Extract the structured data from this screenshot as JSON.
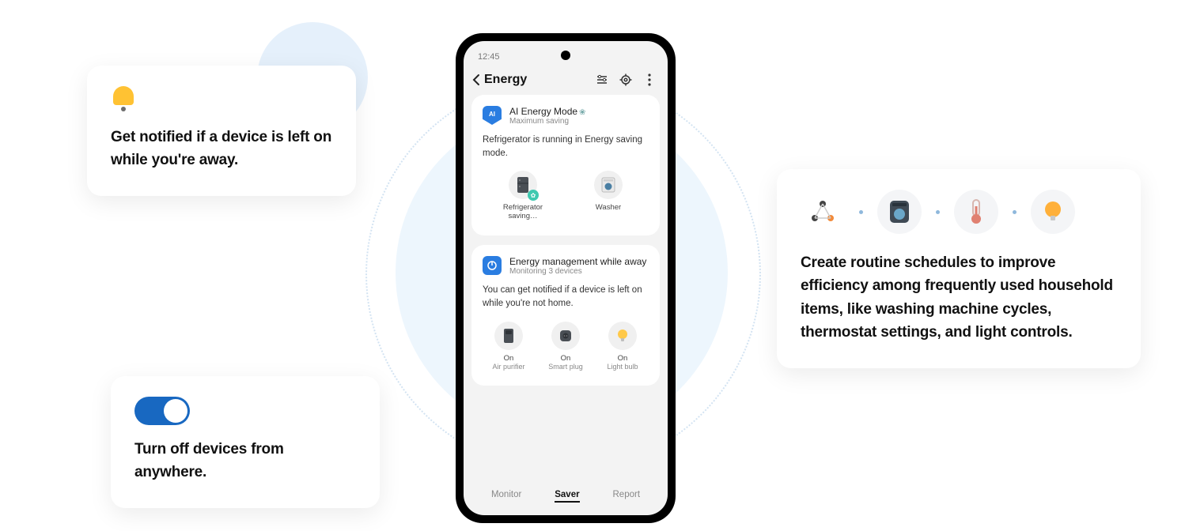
{
  "left_card_notify": {
    "text": "Get notified if a device is left on while you're away."
  },
  "left_card_toggle": {
    "text": "Turn off devices from anywhere."
  },
  "right_card_routine": {
    "text": "Create routine schedules to improve efficiency among frequently used household items, like washing machine cycles, thermostat settings, and light controls."
  },
  "phone": {
    "status_time": "12:45",
    "header": {
      "title": "Energy"
    },
    "panel_ai": {
      "badge_text": "AI",
      "title": "AI Energy Mode",
      "subtitle": "Maximum saving",
      "description": "Refrigerator is running in Energy saving mode.",
      "devices": [
        {
          "label_line1": "Refrigerator",
          "label_line2": "saving…"
        },
        {
          "label_line1": "Washer",
          "label_line2": ""
        }
      ]
    },
    "panel_away": {
      "title": "Energy management while away",
      "subtitle": "Monitoring 3 devices",
      "description": "You can get notified if a device is left on while you're not home.",
      "devices": [
        {
          "status": "On",
          "label": "Air purifier"
        },
        {
          "status": "On",
          "label": "Smart plug"
        },
        {
          "status": "On",
          "label": "Light bulb"
        }
      ]
    },
    "tabs": {
      "monitor": "Monitor",
      "saver": "Saver",
      "report": "Report"
    }
  }
}
